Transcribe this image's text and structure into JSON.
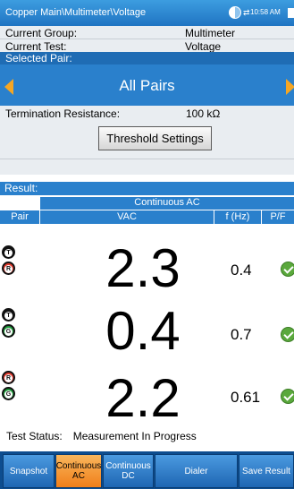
{
  "window": {
    "title": "Copper Main\\Multimeter\\Voltage",
    "time": "10:58 AM",
    "icons": [
      "globe-icon",
      "network-icon",
      "battery-icon"
    ]
  },
  "info": {
    "current_group_label": "Current Group:",
    "current_group_value": "Multimeter",
    "current_test_label": "Current Test:",
    "current_test_value": "Voltage"
  },
  "selected_pair": {
    "label": "Selected Pair:",
    "value": "All Pairs"
  },
  "termination": {
    "label": "Termination Resistance:",
    "value": "100 kΩ"
  },
  "threshold_button": "Threshold Settings",
  "result": {
    "header": "Result:",
    "mode": "Continuous AC",
    "columns": [
      "Pair",
      "VAC",
      "f (Hz)",
      "P/F"
    ],
    "rows": [
      {
        "pair": [
          "T",
          "R"
        ],
        "vac": "2.3",
        "freq": "0.4",
        "pass": true
      },
      {
        "pair": [
          "T",
          "G"
        ],
        "vac": "0.4",
        "freq": "0.7",
        "pass": true
      },
      {
        "pair": [
          "R",
          "G"
        ],
        "vac": "2.2",
        "freq": "0.61",
        "pass": true
      }
    ]
  },
  "test_status": {
    "label": "Test Status:",
    "value": "Measurement In Progress"
  },
  "bottom_tabs": [
    {
      "label": "Snapshot",
      "active": false
    },
    {
      "label": "Continuous AC",
      "active": true
    },
    {
      "label": "Continuous DC",
      "active": false
    },
    {
      "label": "Dialer",
      "active": false
    },
    {
      "label": "Save Result",
      "active": false
    }
  ],
  "colors": {
    "title_blue": "#2a80cc",
    "active_tab": "#f07f1a",
    "arrow_orange": "#f5a623",
    "pass_green": "#5aa83c"
  }
}
